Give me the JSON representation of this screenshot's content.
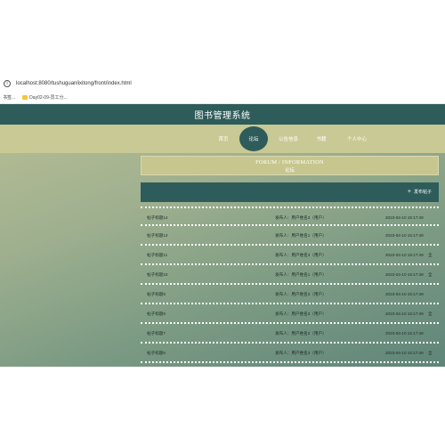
{
  "browser": {
    "url": "localhost:8080/tushuguanlixitong/front/index.html",
    "bookmarks": [
      {
        "label": "书签..."
      },
      {
        "label": "Day02-09-员工分..."
      }
    ]
  },
  "app": {
    "title": "图书管理系统",
    "nav": [
      {
        "label": "首页",
        "active": false
      },
      {
        "label": "论坛",
        "active": true
      },
      {
        "label": "公告信息",
        "active": false
      },
      {
        "label": "书籍",
        "active": false
      },
      {
        "label": "个人中心",
        "active": false
      }
    ],
    "banner": {
      "en": "FORUM / INFORMATION",
      "cn": "论坛"
    },
    "post_button": "发布帖子",
    "posts": [
      {
        "title": "帖子标题14",
        "author": "发布人：用户姓名3（用户）",
        "time": "2023-04-10 15:17:49",
        "pin": ""
      },
      {
        "title": "帖子标题13",
        "author": "发布人：用户姓名1（用户）",
        "time": "2023-04-10 15:17:49",
        "pin": ""
      },
      {
        "title": "帖子标题11",
        "author": "发布人：用户姓名3（用户）",
        "time": "2023-04-10 15:17:49",
        "pin": "全"
      },
      {
        "title": "帖子标题10",
        "author": "发布人：用户姓名1（用户）",
        "time": "2023-04-10 15:17:49",
        "pin": "全"
      },
      {
        "title": "帖子标题9",
        "author": "发布人：用户姓名3（用户）",
        "time": "2023-04-10 15:17:49",
        "pin": ""
      },
      {
        "title": "帖子标题8",
        "author": "发布人：用户姓名3（用户）",
        "time": "2023-04-10 15:17:49",
        "pin": "全"
      },
      {
        "title": "帖子标题7",
        "author": "发布人：用户姓名2（用户）",
        "time": "2023-04-10 15:17:49",
        "pin": ""
      },
      {
        "title": "帖子标题6",
        "author": "发布人：用户姓名3（用户）",
        "time": "2023-04-10 15:17:49",
        "pin": "全"
      }
    ]
  }
}
